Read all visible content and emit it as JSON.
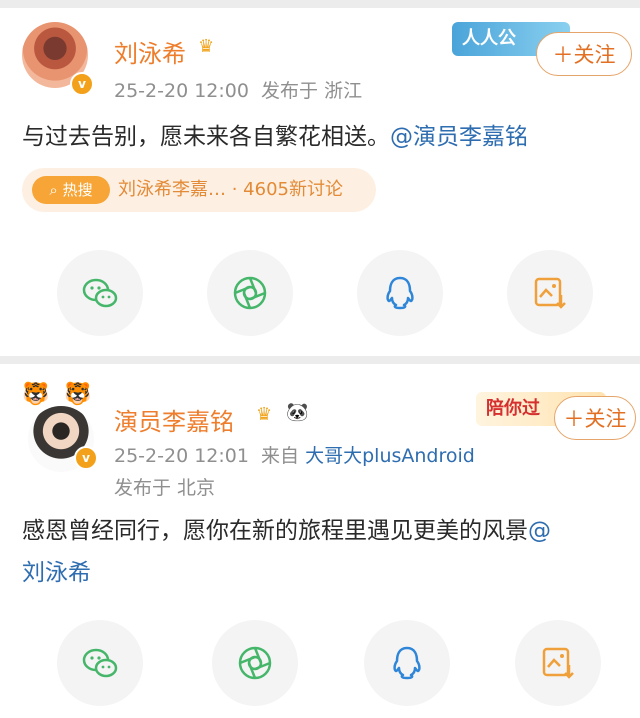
{
  "post1": {
    "name": "刘泳希",
    "time": "25-2-20 12:00",
    "location": "发布于 浙江",
    "content": "与过去告别，愿未来各自繁花相送。",
    "mention": "@演员李嘉铭",
    "follow_label": "＋关注",
    "hot_badge": "热搜",
    "hot_topic": "刘泳希李嘉…",
    "hot_count": "4605新讨论",
    "banner": "人人公"
  },
  "post2": {
    "name": "演员李嘉铭",
    "time": "25-2-20 12:01",
    "source_prefix": "来自",
    "source": "大哥大plusAndroid",
    "location": "发布于 北京",
    "content": "感恩曾经同行，愿你在新的旅程里遇见更美的风景",
    "mention_at": "@",
    "mention_name": "刘泳希",
    "follow_label": "＋关注",
    "banner": "陪你过"
  },
  "icons": [
    "wechat-icon",
    "moments-icon",
    "qq-icon",
    "save-image-icon"
  ],
  "colors": {
    "name": "#ee7d2c",
    "link": "#2e6db0",
    "green": "#45b66a",
    "blue": "#2f86d8",
    "orange": "#f0a03a"
  }
}
